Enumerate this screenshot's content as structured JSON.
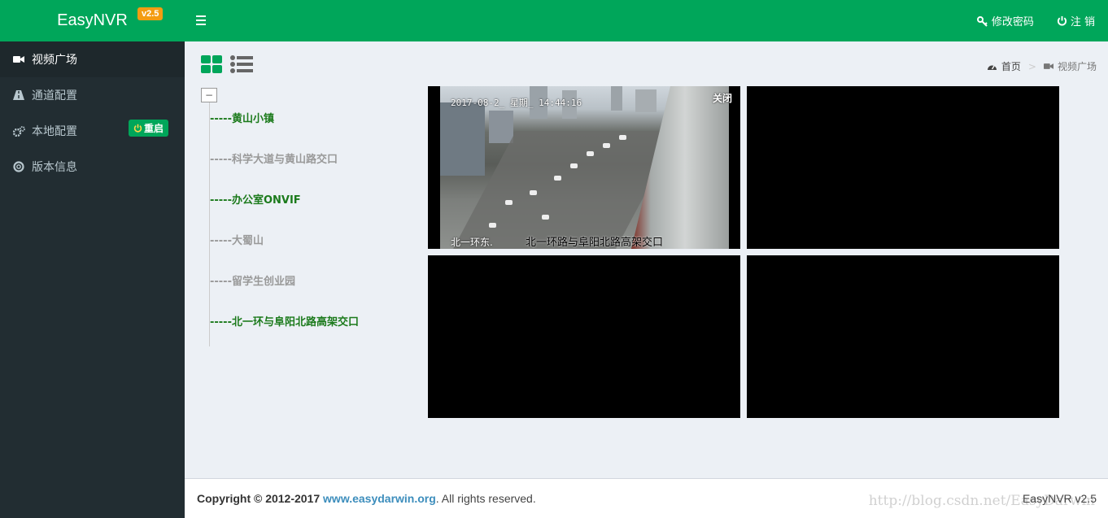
{
  "app": {
    "name": "EasyNVR",
    "version_badge": "v2.5"
  },
  "header": {
    "change_password": "修改密码",
    "logout": "注 销"
  },
  "sidebar": {
    "items": [
      {
        "label": "视频广场",
        "icon": "video-camera-icon",
        "active": true
      },
      {
        "label": "通道配置",
        "icon": "road-icon",
        "active": false
      },
      {
        "label": "本地配置",
        "icon": "cogs-icon",
        "active": false
      },
      {
        "label": "版本信息",
        "icon": "life-ring-icon",
        "active": false
      }
    ],
    "restart_label": "重启"
  },
  "breadcrumb": {
    "home": "首页",
    "current": "视频广场"
  },
  "tree": {
    "collapse_symbol": "−",
    "items": [
      {
        "label": "-----黄山小镇",
        "status": "online"
      },
      {
        "label": "-----科学大道与黄山路交口",
        "status": "offline"
      },
      {
        "label": "-----办公室ONVIF",
        "status": "online"
      },
      {
        "label": "-----大蜀山",
        "status": "offline"
      },
      {
        "label": "-----留学生创业园",
        "status": "offline"
      },
      {
        "label": "-----北一环与阜阳北路高架交口",
        "status": "online"
      }
    ]
  },
  "video": {
    "timestamp": "2017-08-2_ 星期_ 14:44:16",
    "close_label": "关闭",
    "caption_left": "北一环东.",
    "caption_right": "北一环路与阜阳北路高架交口"
  },
  "footer": {
    "copyright": "Copyright © 2012-2017",
    "link": "www.easydarwin.org",
    "rights": ". All rights reserved.",
    "version": "EasyNVR v2.5",
    "watermark": "http://blog.csdn.net/EasyDarwin"
  },
  "colors": {
    "primary": "#00a65a",
    "sidebar": "#222d32",
    "badge": "#f39c12"
  }
}
